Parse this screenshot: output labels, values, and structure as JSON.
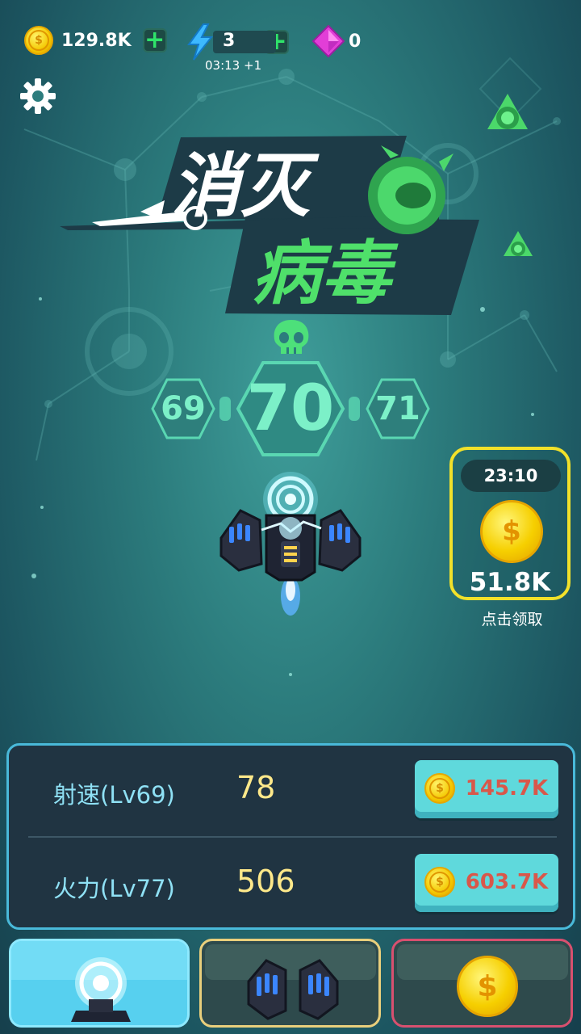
{
  "top_bar": {
    "coins": "129.8K",
    "energy": "3",
    "energy_timer": "03:13 +1",
    "gems": "0"
  },
  "title": {
    "line1": "消灭",
    "line2": "病毒"
  },
  "levels": {
    "previous": "69",
    "current": "70",
    "next": "71"
  },
  "bonus": {
    "timer": "23:10",
    "amount": "51.8K",
    "claim_label": "点击领取"
  },
  "upgrades": [
    {
      "label": "射速(Lv69)",
      "value": "78",
      "cost": "145.7K"
    },
    {
      "label": "火力(Lv77)",
      "value": "506",
      "cost": "603.7K"
    }
  ],
  "tabs": [
    {
      "icon": "turret-icon",
      "active": true
    },
    {
      "icon": "wing-pods-icon",
      "active": false
    },
    {
      "icon": "gold-coin-icon",
      "active": false
    }
  ],
  "colors": {
    "accent_green": "#2fe36a",
    "level_text": "#7cf0c8",
    "bonus_border": "#f2e12a",
    "panel_border": "#49b9d9",
    "cost_text": "#d9574a",
    "value_text": "#ffe98a"
  }
}
